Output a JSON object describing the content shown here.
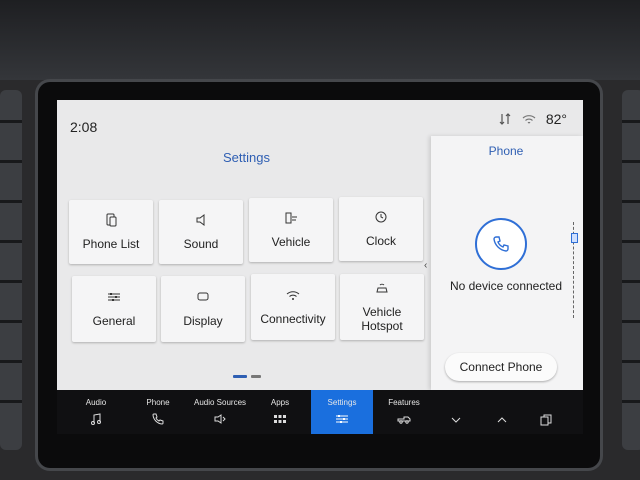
{
  "status": {
    "time": "2:08",
    "temperature": "82°"
  },
  "settings": {
    "title": "Settings",
    "tiles": [
      {
        "label": "Phone List",
        "icon": "phone-list-icon"
      },
      {
        "label": "Sound",
        "icon": "speaker-icon"
      },
      {
        "label": "Vehicle",
        "icon": "vehicle-icon"
      },
      {
        "label": "Clock",
        "icon": "clock-icon"
      },
      {
        "label": "General",
        "icon": "sliders-icon"
      },
      {
        "label": "Display",
        "icon": "display-icon"
      },
      {
        "label": "Connectivity",
        "icon": "wifi-icon"
      },
      {
        "label": "Vehicle Hotspot",
        "icon": "hotspot-icon"
      }
    ],
    "current_page": 1,
    "page_count": 2
  },
  "phone_panel": {
    "title": "Phone",
    "status": "No device connected",
    "button_label": "Connect Phone"
  },
  "nav": [
    {
      "label": "Audio",
      "icon": "music-note-icon",
      "active": false
    },
    {
      "label": "Phone",
      "icon": "phone-icon",
      "active": false
    },
    {
      "label": "Audio Sources",
      "icon": "audio-sources-icon",
      "active": false
    },
    {
      "label": "Apps",
      "icon": "apps-grid-icon",
      "active": false
    },
    {
      "label": "Settings",
      "icon": "settings-sliders-icon",
      "active": true
    },
    {
      "label": "Features",
      "icon": "truck-icon",
      "active": false
    },
    {
      "label": "",
      "icon": "chevron-down-icon",
      "active": false
    },
    {
      "label": "",
      "icon": "chevron-up-icon",
      "active": false
    },
    {
      "label": "",
      "icon": "copy-icon",
      "active": false
    }
  ],
  "colors": {
    "accent": "#2f5fb3",
    "active_nav": "#1a6fde",
    "screen_bg": "#e9e9ea"
  }
}
